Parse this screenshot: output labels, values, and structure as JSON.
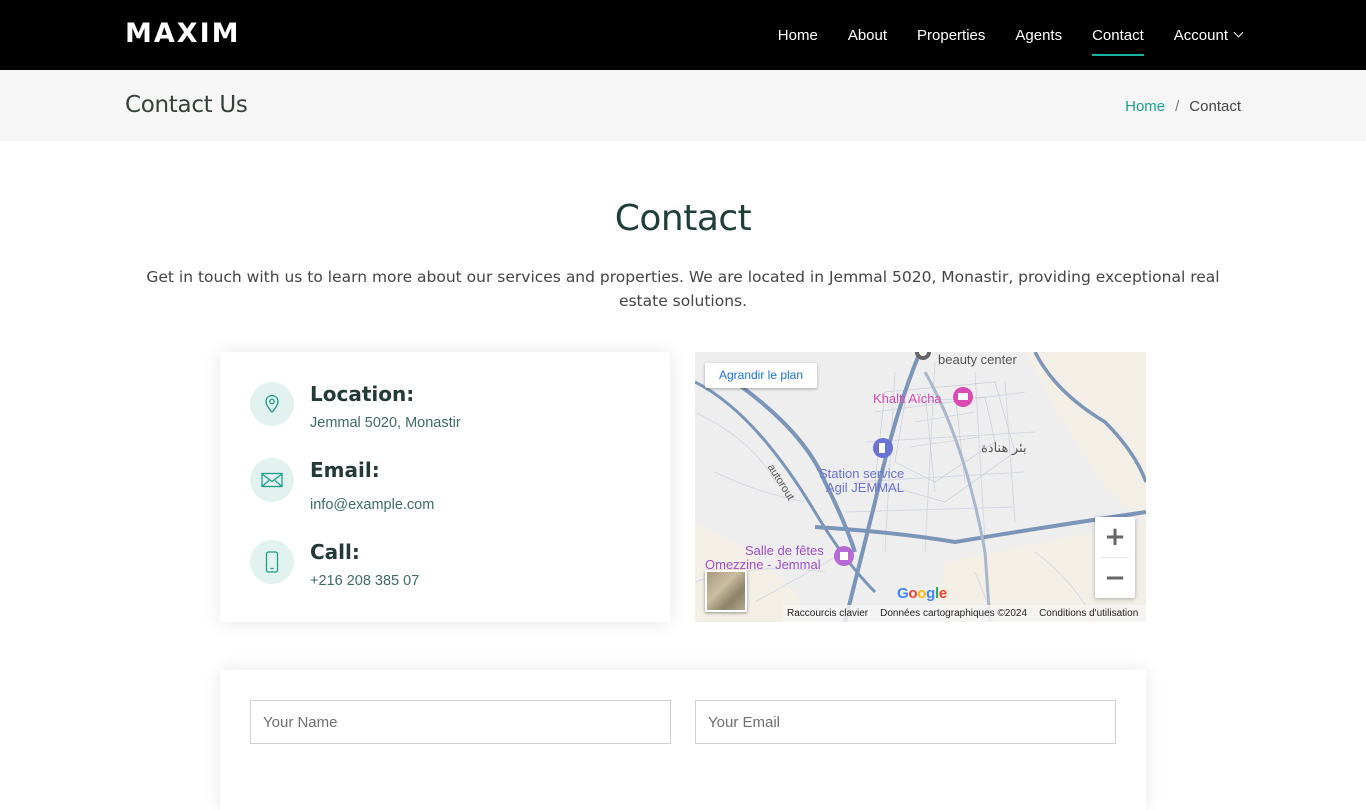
{
  "header": {
    "logo": "MAXIM",
    "nav": [
      "Home",
      "About",
      "Properties",
      "Agents",
      "Contact",
      "Account"
    ],
    "active": "Contact"
  },
  "pagebar": {
    "title": "Contact Us",
    "breadcrumb": {
      "home": "Home",
      "separator": "/",
      "current": "Contact"
    }
  },
  "section": {
    "title": "Contact",
    "description": "Get in touch with us to learn more about our services and properties. We are located in Jemmal 5020, Monastir, providing exceptional real estate solutions."
  },
  "info": {
    "location_label": "Location:",
    "location_value": "Jemmal 5020, Monastir",
    "email_label": "Email:",
    "email_value": "info@example.com",
    "call_label": "Call:",
    "call_value": "+216 208 385 07"
  },
  "map": {
    "enlarge": "Agrandir le plan",
    "labels": {
      "beauty": "beauty center",
      "khalti": "Khalti Aïcha",
      "arabic": "بئر هنادة",
      "station1": "Station service",
      "station2": "Agil JEMMAL",
      "autoroute": "autorout",
      "salle1": "Salle de fêtes",
      "salle2": "Omezzine - Jemmal"
    },
    "zoom_in": "+",
    "zoom_out": "−",
    "google": "Google",
    "footer": [
      "Raccourcis clavier",
      "Données cartographiques ©2024",
      "Conditions d'utilisation"
    ],
    "colors": {
      "road": "#7b95b9",
      "poi_pink": "#d84bb2",
      "poi_blue": "#6a72d6",
      "land": "#f3efe6"
    }
  },
  "form": {
    "name_placeholder": "Your Name",
    "email_placeholder": "Your Email"
  },
  "colors": {
    "accent": "#1c9e8b",
    "topbar": "#000000",
    "pagebar": "#f6f6f6"
  }
}
